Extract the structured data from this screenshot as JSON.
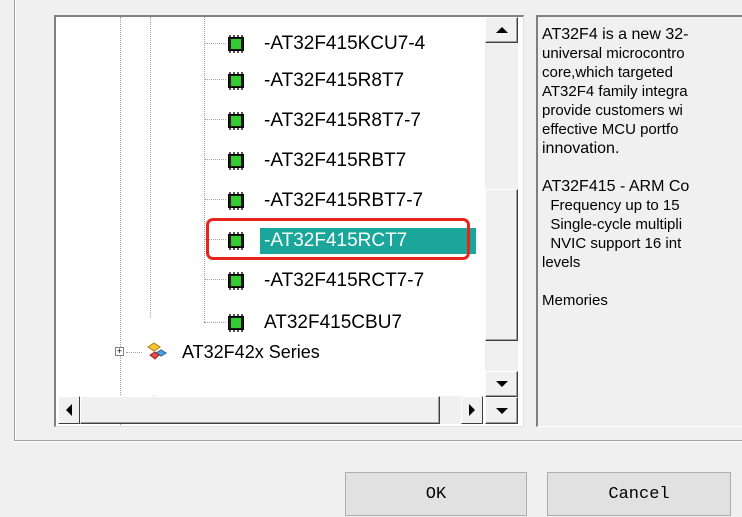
{
  "tree": {
    "items": [
      {
        "label": "-AT32F415KCU7-4"
      },
      {
        "label": "-AT32F415R8T7"
      },
      {
        "label": "-AT32F415R8T7-7"
      },
      {
        "label": "-AT32F415RBT7"
      },
      {
        "label": "-AT32F415RBT7-7"
      },
      {
        "label": "-AT32F415RCT7",
        "selected": true
      },
      {
        "label": "-AT32F415RCT7-7"
      },
      {
        "label": "AT32F415CBU7"
      }
    ],
    "series_label": "AT32F42x Series",
    "expander_symbol": "+",
    "selection_color": "#1aa69a",
    "highlight_color": "#e8241c"
  },
  "description": {
    "lines": [
      "AT32F4 is a new 32-",
      "universal microcontro",
      "core,which targeted",
      "AT32F4 family integra",
      "provide customers wi",
      "effective MCU portfo",
      "innovation.",
      "",
      "AT32F415 - ARM Co",
      "  Frequency up to 15",
      "  Single-cycle multipli",
      "  NVIC support 16 int",
      "levels",
      "",
      "Memories"
    ]
  },
  "buttons": {
    "ok_label": "OK",
    "cancel_label": "Cancel"
  },
  "icons": {
    "chip": "chip-icon",
    "series": "series-icon"
  }
}
